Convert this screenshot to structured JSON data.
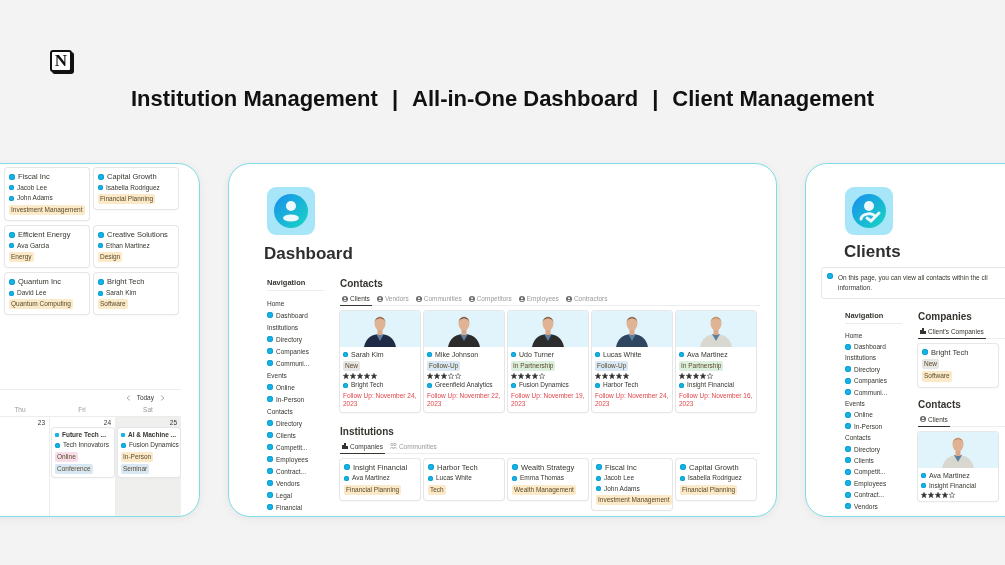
{
  "header": {
    "logo": "N",
    "title_parts": [
      "Institution Management",
      "|",
      "All-in-One Dashboard",
      "|",
      "Client Management"
    ]
  },
  "left_window": {
    "companies": [
      {
        "name": "Fiscal Inc",
        "contacts": [
          "Jacob Lee",
          "John Adams"
        ],
        "tag": {
          "label": "Investment Management",
          "color": "#fbe9c8"
        }
      },
      {
        "name": "Capital Growth",
        "contacts": [
          "Isabella Rodriguez"
        ],
        "tag": {
          "label": "Financial Planning",
          "color": "#fbe9c8"
        }
      },
      {
        "name": "Efficient Energy",
        "contacts": [
          "Ava Garcia"
        ],
        "tag": {
          "label": "Energy",
          "color": "#fbe9c8"
        }
      },
      {
        "name": "Creative Solutions",
        "contacts": [
          "Ethan Martinez"
        ],
        "tag": {
          "label": "Design",
          "color": "#fbe9c8"
        }
      },
      {
        "name": "Quantum Inc",
        "contacts": [
          "David Lee"
        ],
        "tag": {
          "label": "Quantum Computing",
          "color": "#fbe9c8"
        }
      },
      {
        "name": "Bright Tech",
        "contacts": [
          "Sarah Kim"
        ],
        "tag": {
          "label": "Software",
          "color": "#fbe9c8"
        }
      }
    ],
    "calendar": {
      "today": "Today",
      "days": [
        {
          "weekday": "Thu",
          "date": "23",
          "weekend": false
        },
        {
          "weekday": "Fri",
          "date": "24",
          "weekend": false,
          "events": [
            {
              "title": "Future Tech ...",
              "org": "Tech Innovators",
              "tags": [
                {
                  "label": "Online",
                  "color": "#f6dde8"
                },
                {
                  "label": "Conference",
                  "color": "#d8e8f5"
                }
              ]
            }
          ]
        },
        {
          "weekday": "Sat",
          "date": "25",
          "weekend": true,
          "events": [
            {
              "title": "AI & Machine ...",
              "org": "Fusion Dynamics",
              "tags": [
                {
                  "label": "In-Person",
                  "color": "#fbe9c8"
                },
                {
                  "label": "Seminar",
                  "color": "#d8e8f5"
                }
              ]
            }
          ]
        }
      ]
    }
  },
  "dashboard_window": {
    "title": "Dashboard",
    "navigation": {
      "heading": "Navigation",
      "sections": [
        {
          "label": "Home",
          "children": [
            {
              "label": "Dashboard"
            }
          ]
        },
        {
          "label": "Institutions",
          "children": [
            {
              "label": "Directory"
            },
            {
              "label": "Companies"
            },
            {
              "label": "Communi..."
            }
          ]
        },
        {
          "label": "Events",
          "children": [
            {
              "label": "Online"
            },
            {
              "label": "In-Person"
            }
          ]
        },
        {
          "label": "Contacts",
          "children": [
            {
              "label": "Directory"
            },
            {
              "label": "Clients"
            },
            {
              "label": "Competit..."
            },
            {
              "label": "Employees"
            },
            {
              "label": "Contract..."
            },
            {
              "label": "Vendors"
            },
            {
              "label": "Legal"
            },
            {
              "label": "Financial"
            }
          ]
        }
      ]
    },
    "contacts": {
      "heading": "Contacts",
      "tabs": [
        {
          "label": "Clients",
          "selected": true
        },
        {
          "label": "Vendors",
          "selected": false
        },
        {
          "label": "Communities",
          "selected": false
        },
        {
          "label": "Competitors",
          "selected": false
        },
        {
          "label": "Employees",
          "selected": false
        },
        {
          "label": "Contractors",
          "selected": false
        }
      ],
      "cards": [
        {
          "name": "Sarah Kim",
          "status": {
            "label": "New",
            "color": "#e6e6e4"
          },
          "stars": 5,
          "company": "Bright Tech",
          "follow_up": "Follow Up: November 24, 2023"
        },
        {
          "name": "Mike Johnson",
          "status": {
            "label": "Follow-Up",
            "color": "#d8e8f5"
          },
          "stars": 3,
          "company": "Greenfield Analytics",
          "follow_up": "Follow Up: November 22, 2023"
        },
        {
          "name": "Udo Turner",
          "status": {
            "label": "In Partnership",
            "color": "#dcefdc"
          },
          "stars": 4,
          "company": "Fusion Dynamics",
          "follow_up": "Follow Up: November 19, 2023"
        },
        {
          "name": "Lucas White",
          "status": {
            "label": "Follow-Up",
            "color": "#d8e8f5"
          },
          "stars": 5,
          "company": "Harbor Tech",
          "follow_up": "Follow Up: November 24, 2023"
        },
        {
          "name": "Ava Martinez",
          "status": {
            "label": "In Partnership",
            "color": "#dcefdc"
          },
          "stars": 4,
          "company": "Insight Financial",
          "follow_up": "Follow Up: November 16, 2023"
        }
      ]
    },
    "institutions": {
      "heading": "Institutions",
      "tabs": [
        {
          "label": "Companies",
          "selected": true
        },
        {
          "label": "Communities",
          "selected": false
        }
      ],
      "cards": [
        {
          "name": "Insight Financial",
          "contacts": [
            "Ava Martinez"
          ],
          "tag": {
            "label": "Financial Planning",
            "color": "#fbe9c8"
          }
        },
        {
          "name": "Harbor Tech",
          "contacts": [
            "Lucas White"
          ],
          "tag": {
            "label": "Tech",
            "color": "#fbe9c8"
          }
        },
        {
          "name": "Wealth Strategy",
          "contacts": [
            "Emma Thomas"
          ],
          "tag": {
            "label": "Wealth Management",
            "color": "#fbe9c8"
          }
        },
        {
          "name": "Fiscal Inc",
          "contacts": [
            "Jacob Lee",
            "John Adams"
          ],
          "tag": {
            "label": "Investment Management",
            "color": "#fbe9c8"
          }
        },
        {
          "name": "Capital Growth",
          "contacts": [
            "Isabella Rodriguez"
          ],
          "tag": {
            "label": "Financial Planning",
            "color": "#fbe9c8"
          }
        }
      ]
    }
  },
  "clients_window": {
    "title": "Clients",
    "callout": [
      "On this page, you can view all contacts within the cli",
      "information."
    ],
    "navigation": {
      "heading": "Navigation",
      "sections": [
        {
          "label": "Home",
          "children": [
            {
              "label": "Dashboard"
            }
          ]
        },
        {
          "label": "Institutions",
          "children": [
            {
              "label": "Directory"
            },
            {
              "label": "Companies"
            },
            {
              "label": "Communi..."
            }
          ]
        },
        {
          "label": "Events",
          "children": [
            {
              "label": "Online"
            },
            {
              "label": "In-Person"
            }
          ]
        },
        {
          "label": "Contacts",
          "children": [
            {
              "label": "Directory"
            },
            {
              "label": "Clients"
            },
            {
              "label": "Competit..."
            },
            {
              "label": "Employees"
            },
            {
              "label": "Contract..."
            },
            {
              "label": "Vendors"
            }
          ]
        }
      ]
    },
    "companies": {
      "heading": "Companies",
      "tabs": [
        {
          "label": "Client's Companies",
          "selected": true
        }
      ],
      "cards": [
        {
          "name": "Bright Tech",
          "status": {
            "label": "New",
            "color": "#e6e6e4"
          },
          "tag": {
            "label": "Software",
            "color": "#fbe9c8"
          }
        }
      ]
    },
    "contacts": {
      "heading": "Contacts",
      "tabs": [
        {
          "label": "Clients",
          "selected": true
        }
      ],
      "cards": [
        {
          "name": "Ava Martinez",
          "company": "Insight Financial",
          "stars": 4
        }
      ]
    }
  }
}
